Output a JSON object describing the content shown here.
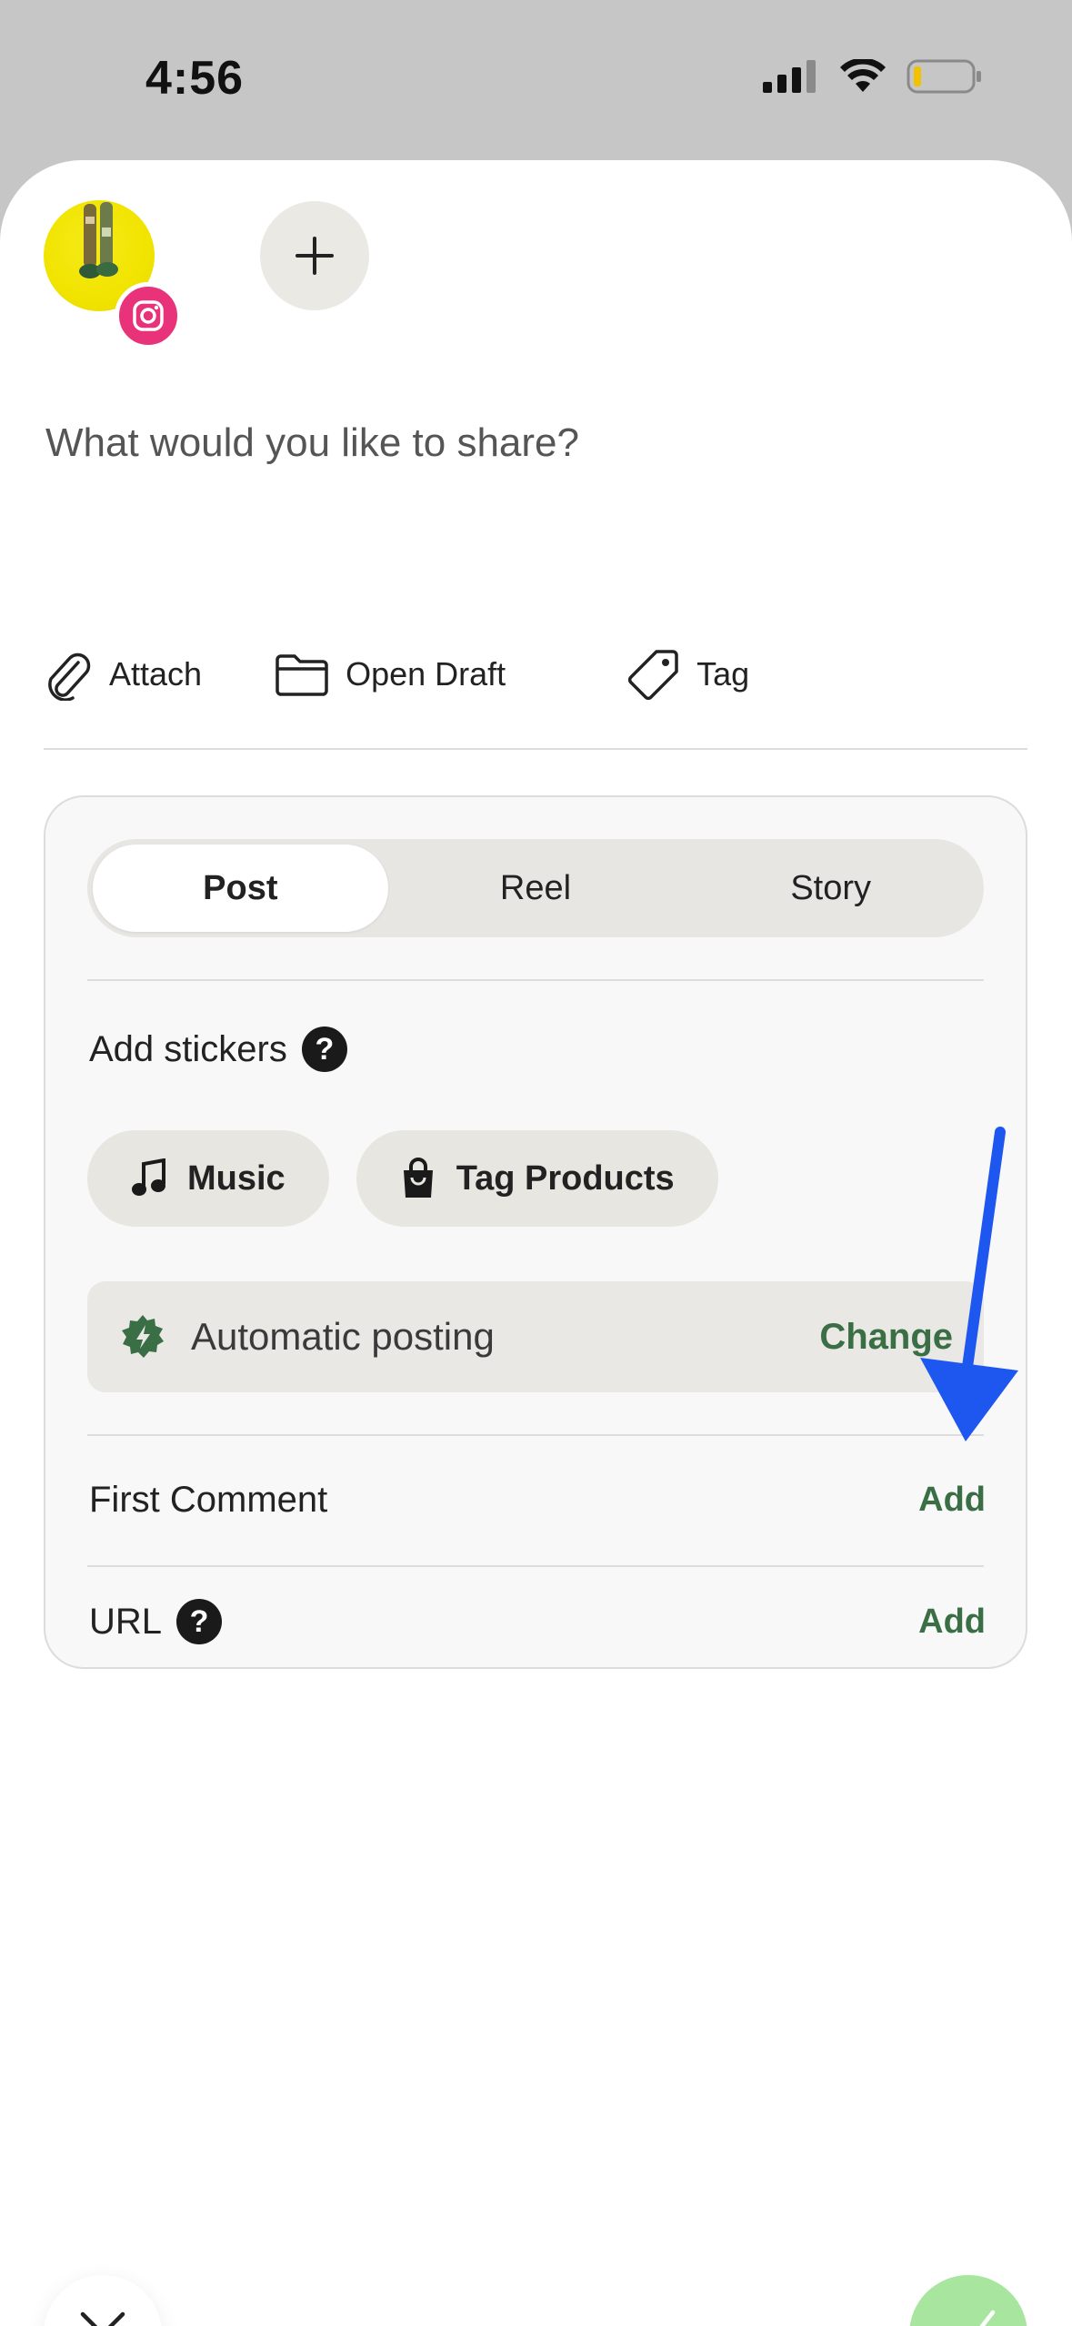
{
  "status_bar": {
    "time": "4:56"
  },
  "compose": {
    "placeholder": "What would you like to share?"
  },
  "toolbar": {
    "attach_label": "Attach",
    "open_draft_label": "Open Draft",
    "tag_label": "Tag"
  },
  "post_types": {
    "tabs": [
      "Post",
      "Reel",
      "Story"
    ],
    "selected": "Post"
  },
  "stickers": {
    "label": "Add stickers",
    "help": "?",
    "music_label": "Music",
    "tag_products_label": "Tag Products"
  },
  "automatic_posting": {
    "label": "Automatic posting",
    "action": "Change"
  },
  "first_comment": {
    "label": "First Comment",
    "action": "Add"
  },
  "url": {
    "label": "URL",
    "help": "?",
    "action": "Add"
  },
  "colors": {
    "accent_green": "#3a6e45",
    "confirm_green": "#a8e6a0",
    "instagram_pink": "#e8327a",
    "annotation_blue": "#1e56f0"
  }
}
